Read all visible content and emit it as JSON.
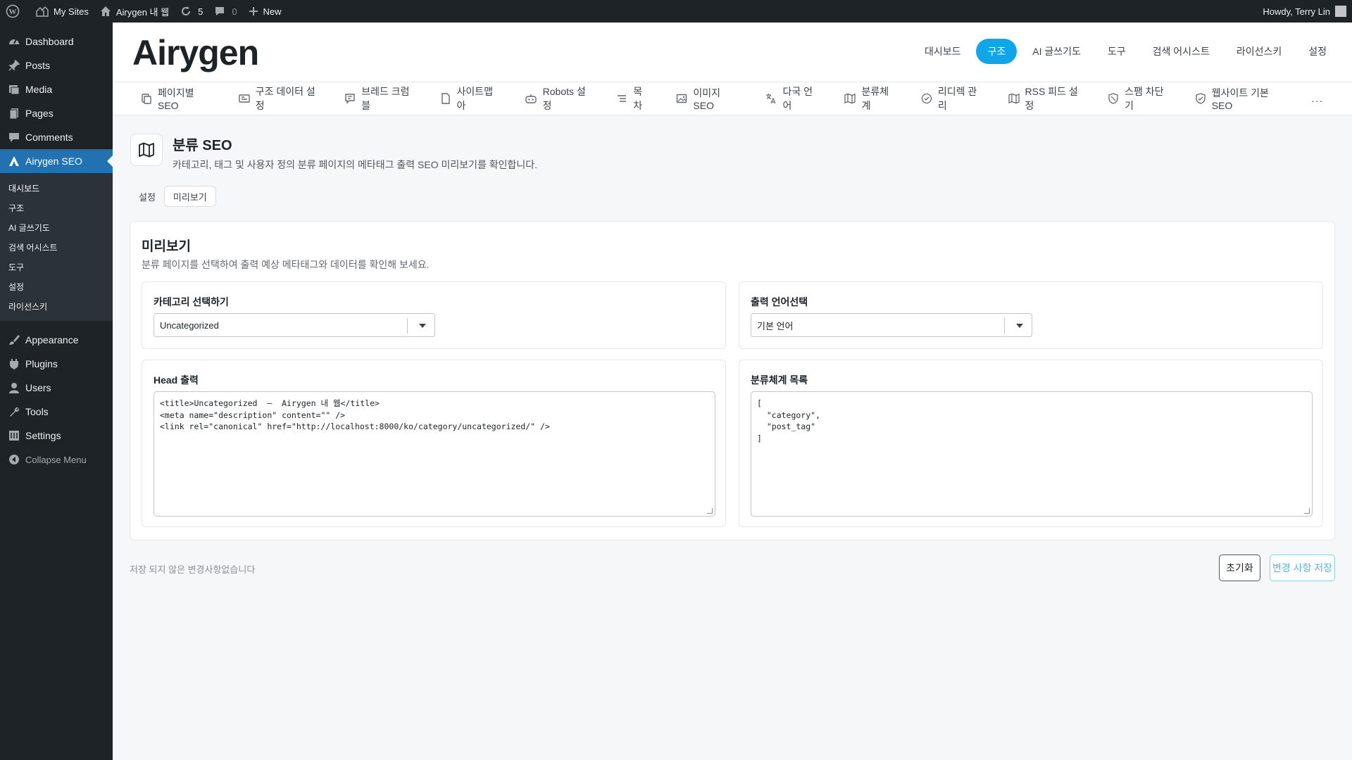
{
  "adminbar": {
    "my_sites": "My Sites",
    "site_name": "Airygen 내 웹",
    "updates_count": "5",
    "comments_count": "0",
    "new_label": "New",
    "howdy": "Howdy, Terry Lin"
  },
  "sidebar": {
    "items_top": [
      {
        "label": "Dashboard",
        "icon": "dashboard-icon"
      },
      {
        "label": "Posts",
        "icon": "pin-icon"
      },
      {
        "label": "Media",
        "icon": "media-icon"
      },
      {
        "label": "Pages",
        "icon": "pages-icon"
      },
      {
        "label": "Comments",
        "icon": "comment-icon"
      }
    ],
    "current": {
      "label": "Airygen SEO",
      "icon": "airygen-logo-icon"
    },
    "submenu": [
      "대시보드",
      "구조",
      "AI 글쓰기도",
      "검색 어시스트",
      "도구",
      "설정",
      "라이선스키"
    ],
    "items_bottom": [
      {
        "label": "Appearance",
        "icon": "brush-icon"
      },
      {
        "label": "Plugins",
        "icon": "plug-icon"
      },
      {
        "label": "Users",
        "icon": "user-icon"
      },
      {
        "label": "Tools",
        "icon": "wrench-icon"
      },
      {
        "label": "Settings",
        "icon": "settings-icon"
      }
    ],
    "collapse": "Collapse Menu"
  },
  "header": {
    "logo": "Airygen",
    "nav": [
      "대시보드",
      "구조",
      "AI 글쓰기도",
      "도구",
      "검색 어시스트",
      "라이선스키",
      "설정"
    ],
    "nav_active_index": 1
  },
  "tabs": [
    {
      "label": "페이지별 SEO",
      "icon": "page-copy-icon"
    },
    {
      "label": "구조 데이터 설정",
      "icon": "card-icon"
    },
    {
      "label": "브레드 크럼블",
      "icon": "message-icon"
    },
    {
      "label": "사이트맵아",
      "icon": "file-icon"
    },
    {
      "label": "Robots 설정",
      "icon": "robot-icon"
    },
    {
      "label": "목차",
      "icon": "list-icon"
    },
    {
      "label": "이미지 SEO",
      "icon": "image-icon"
    },
    {
      "label": "다국 언어",
      "icon": "translate-icon"
    },
    {
      "label": "분류체계",
      "icon": "map-icon"
    },
    {
      "label": "리디렉 관리",
      "icon": "check-circle-icon"
    },
    {
      "label": "RSS 피드 설정",
      "icon": "rss-icon"
    },
    {
      "label": "스팸 차단기",
      "icon": "shield-icon"
    },
    {
      "label": "웹사이트 기본 SEO",
      "icon": "shield-check-icon"
    },
    {
      "label": "...",
      "icon": ""
    }
  ],
  "page": {
    "title": "분류 SEO",
    "description": "카테고리, 태그 및 사용자 정의 분류 페이지의 메타태그 출력 SEO 미리보기를 확인합니다.",
    "subtabs": [
      "설정",
      "미리보기"
    ],
    "subtab_active_index": 1
  },
  "panel": {
    "title": "미리보기",
    "description": "분류 페이지를 선택하여 출력 예상 메타태그와 데이터를 확인해 보세요.",
    "taxonomy_label": "카테고리 선택하기",
    "taxonomy_value": "Uncategorized",
    "language_label": "출력 언어선택",
    "language_value": "기본 언어",
    "head_label": "Head 출력",
    "head_code": "<title>Uncategorized  –  Airygen 내 웹</title>\n<meta name=\"description\" content=\"\" />\n<link rel=\"canonical\" href=\"http://localhost:8000/ko/category/uncategorized/\" />",
    "data_label": "분류체계 목록",
    "data_code": "[\n  \"category\",\n  \"post_tag\"\n]"
  },
  "footer": {
    "note": "저장 되지 않은 변경사항없습니다",
    "reset": "초기화",
    "save": "변경 사항 저장"
  },
  "colors": {
    "accent": "#0ea5e9",
    "wp_blue": "#2271b1",
    "admin_dark": "#1d2327"
  }
}
